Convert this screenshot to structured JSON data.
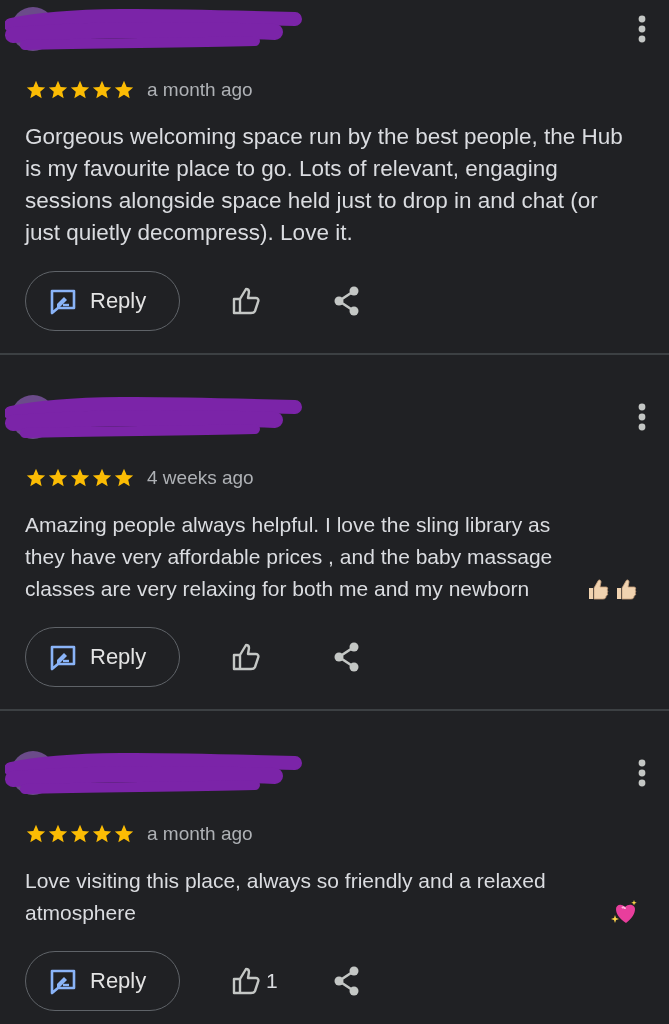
{
  "reviews": [
    {
      "stars": 5,
      "time": "a month ago",
      "text": "Gorgeous welcoming space run by the best people, the Hub is my favourite place to go. Lots of relevant, engaging sessions alongside space held just to drop in and chat (or just quietly decompress). Love it.",
      "reply_label": "Reply"
    },
    {
      "stars": 5,
      "time": "4 weeks ago",
      "text": "Amazing people always helpful. I love the sling library as they have very affordable prices , and the baby massage classes are very relaxing for both me and my newborn",
      "trailing_icons": [
        {
          "kind": "thumbs-up"
        },
        {
          "kind": "thumbs-up"
        }
      ],
      "reply_label": "Reply"
    },
    {
      "stars": 5,
      "time": "a month ago",
      "text": "Love visiting this place, always so friendly and a relaxed atmosphere",
      "trailing_icons": [
        {
          "kind": "sparkling-heart"
        }
      ],
      "reply_label": "Reply",
      "likes": "1"
    }
  ]
}
